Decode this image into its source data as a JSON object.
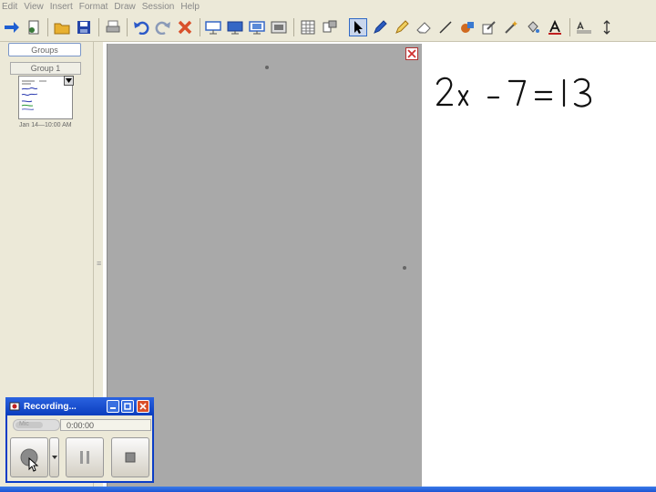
{
  "menu": [
    "Edit",
    "View",
    "Insert",
    "Format",
    "Draw",
    "Session",
    "Help"
  ],
  "toolbar": {
    "icons": [
      {
        "name": "forward-arrow-icon",
        "color": "#1f5fd1"
      },
      {
        "name": "open-file-icon",
        "color": "#3a7a3a"
      },
      {
        "name": "folder-icon",
        "color": "#e0a020"
      },
      {
        "name": "save-icon",
        "color": "#2545a8"
      },
      {
        "name": "print-icon",
        "color": "#777777"
      },
      {
        "name": "undo-icon",
        "color": "#2c5ac8"
      },
      {
        "name": "redo-icon",
        "color": "#8a9ab8"
      },
      {
        "name": "delete-icon",
        "color": "#d9502a"
      },
      {
        "name": "screen-icon",
        "color": "#3567c5"
      },
      {
        "name": "monitor-icon",
        "color": "#3567c5"
      },
      {
        "name": "monitor-share-icon",
        "color": "#3567c5"
      },
      {
        "name": "image-icon",
        "color": "#555555"
      },
      {
        "name": "table-icon",
        "color": "#555555"
      },
      {
        "name": "shapes-icon",
        "color": "#555555"
      },
      {
        "name": "select-arrow-icon",
        "color": "#000000"
      },
      {
        "name": "pen-icon",
        "color": "#2b5bc0"
      },
      {
        "name": "highlighter-icon",
        "color": "#c08020"
      },
      {
        "name": "eraser-icon",
        "color": "#888888"
      },
      {
        "name": "line-icon",
        "color": "#333333"
      },
      {
        "name": "fill-icon",
        "color": "#d06a20"
      },
      {
        "name": "brush-icon",
        "color": "#555555"
      },
      {
        "name": "magic-wand-icon",
        "color": "#555555"
      },
      {
        "name": "paint-bucket-icon",
        "color": "#3a7ad0"
      },
      {
        "name": "text-icon",
        "color": "#c02020"
      },
      {
        "name": "text-format-icon",
        "color": "#333333"
      },
      {
        "name": "resize-vertical-icon",
        "color": "#333333"
      }
    ]
  },
  "sidebar": {
    "groups_label": "Groups",
    "group_tab_label": "Group 1",
    "thumbnail_timestamp": "Jan 14—10:00 AM"
  },
  "canvas": {
    "equation": "2x − 7 = 13"
  },
  "recording": {
    "title": "Recording...",
    "meter_label": "Mic",
    "time": "0:00:00",
    "accent": "#0b3dbe"
  }
}
